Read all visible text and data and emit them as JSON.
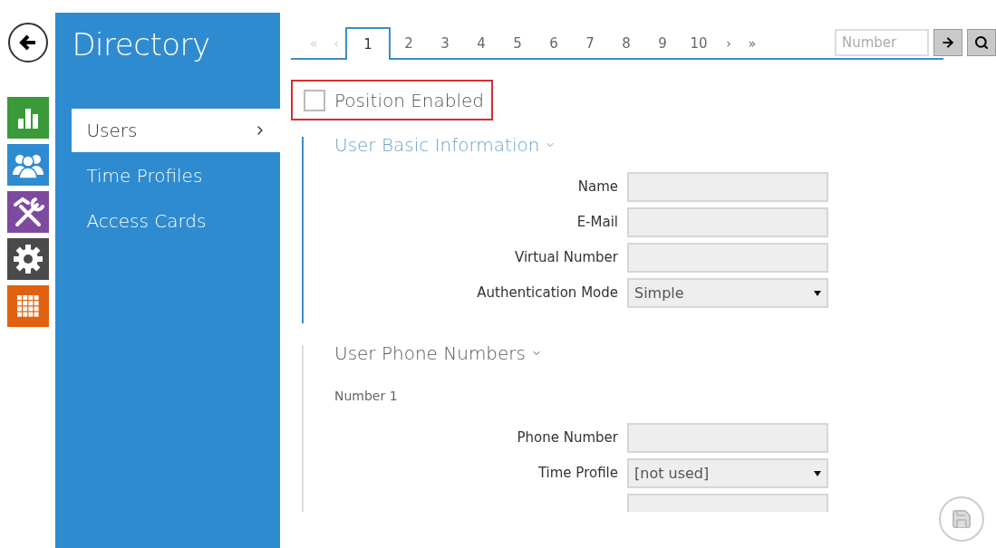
{
  "rail": [
    {
      "kind": "back"
    },
    {
      "kind": "chart",
      "color": "#3a9a3a"
    },
    {
      "kind": "users",
      "color": "#2f8bd0"
    },
    {
      "kind": "tools",
      "color": "#7d4aa0"
    },
    {
      "kind": "gear",
      "color": "#4a4a4a"
    },
    {
      "kind": "grid",
      "color": "#e0620f"
    }
  ],
  "sidebar": {
    "title": "Directory",
    "items": [
      {
        "label": "Users",
        "selected": true
      },
      {
        "label": "Time Profiles",
        "selected": false
      },
      {
        "label": "Access Cards",
        "selected": false
      }
    ]
  },
  "pagination": {
    "first": "«",
    "prev": "‹",
    "next": "›",
    "last": "»",
    "pages": [
      {
        "label": "1",
        "selected": true
      },
      {
        "label": "2",
        "selected": false
      },
      {
        "label": "3",
        "selected": false
      },
      {
        "label": "4",
        "selected": false
      },
      {
        "label": "5",
        "selected": false
      },
      {
        "label": "6",
        "selected": false
      },
      {
        "label": "7",
        "selected": false
      },
      {
        "label": "8",
        "selected": false
      },
      {
        "label": "9",
        "selected": false
      },
      {
        "label": "10",
        "selected": false
      }
    ],
    "search": {
      "placeholder": "Number"
    }
  },
  "position_enabled": {
    "label": "Position Enabled",
    "checked": false
  },
  "sections": [
    {
      "title": "User Basic Information",
      "highlighted": true,
      "groups": [
        {
          "fields": [
            {
              "label": "Name",
              "kind": "text"
            },
            {
              "label": "E-Mail",
              "kind": "text"
            },
            {
              "label": "Virtual Number",
              "kind": "text"
            },
            {
              "label": "Authentication Mode",
              "kind": "select",
              "value": "Simple"
            }
          ]
        }
      ]
    },
    {
      "title": "User Phone Numbers",
      "highlighted": false,
      "groups": [
        {
          "title": "Number 1",
          "fields": [
            {
              "label": "Phone Number",
              "kind": "text"
            },
            {
              "label": "Time Profile",
              "kind": "select",
              "value": "[not used]"
            },
            {
              "kind": "text"
            }
          ]
        }
      ]
    }
  ]
}
